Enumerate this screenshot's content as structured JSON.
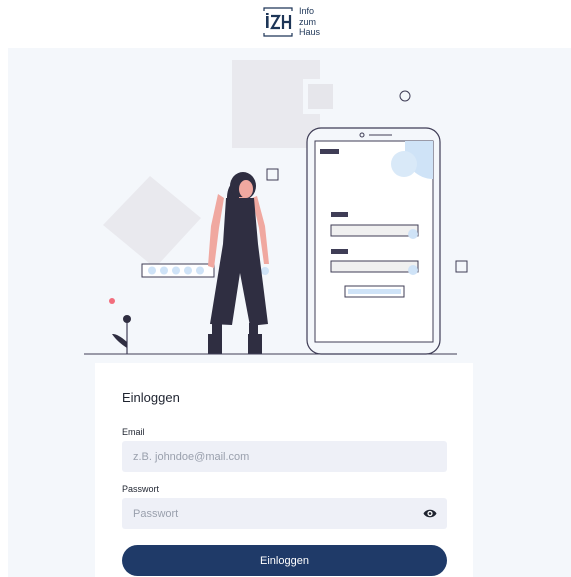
{
  "logo": {
    "lines": [
      "Info",
      "zum",
      "Haus"
    ]
  },
  "login": {
    "title": "Einloggen",
    "email_label": "Email",
    "email_placeholder": "z.B. johndoe@mail.com",
    "password_label": "Passwort",
    "password_placeholder": "Passwort",
    "submit_label": "Einloggen"
  },
  "icons": {
    "logo": "izh-logo-icon",
    "password_toggle": "eye-icon"
  },
  "colors": {
    "primary": "#1f3a68",
    "page_background": "#f4f7fb",
    "input_background": "#eef0f7",
    "illustration_accent": "#cfe3f7",
    "illustration_figure": "#2f2e41",
    "illustration_skin": "#f0a8a0",
    "illustration_flower": "#f26d7d"
  }
}
